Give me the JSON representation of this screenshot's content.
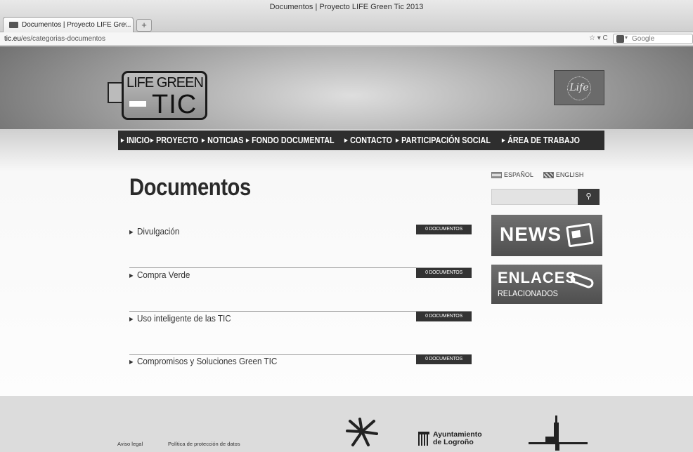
{
  "browser": {
    "window_title": "Documentos | Proyecto LIFE Green Tic 2013",
    "tab_title": "Documentos | Proyecto LIFE Gre...",
    "tab_close": "×",
    "new_tab": "+",
    "url_domain": "tic.eu",
    "url_path": "/es/categorias-documentos",
    "url_icons": "☆ ▾ C",
    "search_engine": "Google"
  },
  "header": {
    "logo_line1": "LIFE GREEN",
    "logo_line2": "TIC",
    "eu_label": "Life"
  },
  "nav": {
    "items": [
      "INICIO",
      "PROYECTO",
      "NOTICIAS",
      "FONDO DOCUMENTAL",
      "CONTACTO",
      "PARTICIPACIÓN SOCIAL",
      "ÁREA DE TRABAJO"
    ]
  },
  "sidebar": {
    "lang_es": "ESPAÑOL",
    "lang_en": "ENGLISH",
    "search_button_icon": "search-icon",
    "news_label": "NEWS",
    "links_title": "ENLACES",
    "links_sub": "RELACIONADOS"
  },
  "main": {
    "heading": "Documentos",
    "categories": [
      {
        "name": "Divulgación",
        "count": "0 DOCUMENTOS"
      },
      {
        "name": "Compra Verde",
        "count": "0 DOCUMENTOS"
      },
      {
        "name": "Uso inteligente de las TIC",
        "count": "0 DOCUMENTOS"
      },
      {
        "name": "Compromisos y Soluciones Green TIC",
        "count": "0 DOCUMENTOS"
      }
    ]
  },
  "footer": {
    "legal": "Aviso legal",
    "privacy": "Política de protección de datos",
    "ayto_line1": "Ayuntamiento",
    "ayto_line2": "de Logroño"
  }
}
